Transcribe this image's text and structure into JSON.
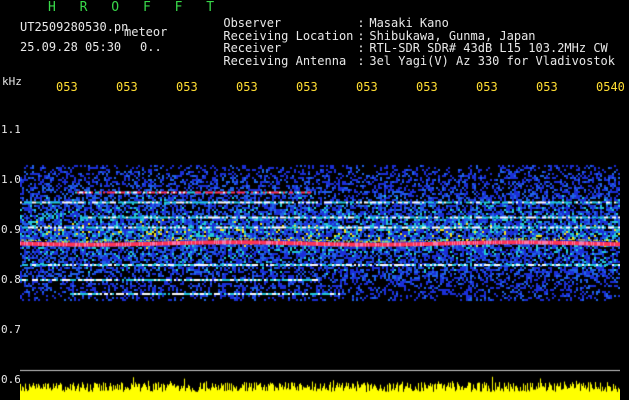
{
  "header": {
    "brand": "H R O F F T",
    "filename": "UT2509280530.pn",
    "mode_label": "meteor",
    "datetime": "25.09.28 05:30",
    "status_value": "0.."
  },
  "info": [
    {
      "key": "Observer",
      "sep": ":",
      "value": "Masaki Kano"
    },
    {
      "key": "Receiving Location",
      "sep": ":",
      "value": "Shibukawa, Gunma, Japan"
    },
    {
      "key": "Receiver",
      "sep": ":",
      "value": "RTL-SDR SDR# 43dB L15 103.2MHz CW"
    },
    {
      "key": "Receiving Antenna",
      "sep": ":",
      "value": "3el Yagi(V) Az 330 for Vladivostok"
    }
  ],
  "axis": {
    "freq_unit": "kHz",
    "freq_ticks": [
      {
        "label": "1.1",
        "value": 1.1
      },
      {
        "label": "1.0",
        "value": 1.0
      },
      {
        "label": "0.9",
        "value": 0.9
      },
      {
        "label": "0.8",
        "value": 0.8
      },
      {
        "label": "0.7",
        "value": 0.7
      },
      {
        "label": "0.6",
        "value": 0.6
      }
    ],
    "time_ticks": [
      "053",
      "053",
      "053",
      "053",
      "053",
      "053",
      "053",
      "053",
      "053",
      "0540"
    ]
  },
  "colors": {
    "background": "#000000",
    "brand": "#39d94a",
    "time_ticks": "#ffdd33",
    "noise_bars": "#ffff00",
    "carrier": "#ff3355",
    "signal_low": "#1b2fd8",
    "signal_mid": "#22c8d6",
    "signal_high": "#f0e020"
  }
}
